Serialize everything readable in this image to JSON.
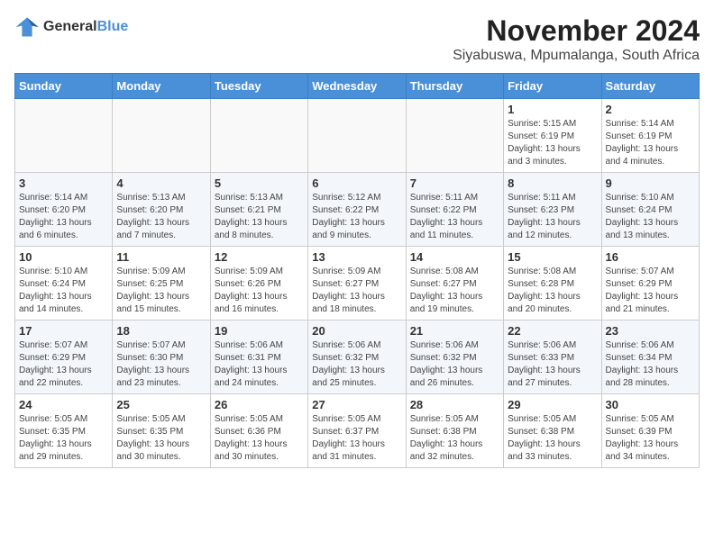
{
  "logo": {
    "line1": "General",
    "line2": "Blue"
  },
  "title": "November 2024",
  "subtitle": "Siyabuswa, Mpumalanga, South Africa",
  "weekdays": [
    "Sunday",
    "Monday",
    "Tuesday",
    "Wednesday",
    "Thursday",
    "Friday",
    "Saturday"
  ],
  "weeks": [
    [
      {
        "day": "",
        "info": ""
      },
      {
        "day": "",
        "info": ""
      },
      {
        "day": "",
        "info": ""
      },
      {
        "day": "",
        "info": ""
      },
      {
        "day": "",
        "info": ""
      },
      {
        "day": "1",
        "info": "Sunrise: 5:15 AM\nSunset: 6:19 PM\nDaylight: 13 hours\nand 3 minutes."
      },
      {
        "day": "2",
        "info": "Sunrise: 5:14 AM\nSunset: 6:19 PM\nDaylight: 13 hours\nand 4 minutes."
      }
    ],
    [
      {
        "day": "3",
        "info": "Sunrise: 5:14 AM\nSunset: 6:20 PM\nDaylight: 13 hours\nand 6 minutes."
      },
      {
        "day": "4",
        "info": "Sunrise: 5:13 AM\nSunset: 6:20 PM\nDaylight: 13 hours\nand 7 minutes."
      },
      {
        "day": "5",
        "info": "Sunrise: 5:13 AM\nSunset: 6:21 PM\nDaylight: 13 hours\nand 8 minutes."
      },
      {
        "day": "6",
        "info": "Sunrise: 5:12 AM\nSunset: 6:22 PM\nDaylight: 13 hours\nand 9 minutes."
      },
      {
        "day": "7",
        "info": "Sunrise: 5:11 AM\nSunset: 6:22 PM\nDaylight: 13 hours\nand 11 minutes."
      },
      {
        "day": "8",
        "info": "Sunrise: 5:11 AM\nSunset: 6:23 PM\nDaylight: 13 hours\nand 12 minutes."
      },
      {
        "day": "9",
        "info": "Sunrise: 5:10 AM\nSunset: 6:24 PM\nDaylight: 13 hours\nand 13 minutes."
      }
    ],
    [
      {
        "day": "10",
        "info": "Sunrise: 5:10 AM\nSunset: 6:24 PM\nDaylight: 13 hours\nand 14 minutes."
      },
      {
        "day": "11",
        "info": "Sunrise: 5:09 AM\nSunset: 6:25 PM\nDaylight: 13 hours\nand 15 minutes."
      },
      {
        "day": "12",
        "info": "Sunrise: 5:09 AM\nSunset: 6:26 PM\nDaylight: 13 hours\nand 16 minutes."
      },
      {
        "day": "13",
        "info": "Sunrise: 5:09 AM\nSunset: 6:27 PM\nDaylight: 13 hours\nand 18 minutes."
      },
      {
        "day": "14",
        "info": "Sunrise: 5:08 AM\nSunset: 6:27 PM\nDaylight: 13 hours\nand 19 minutes."
      },
      {
        "day": "15",
        "info": "Sunrise: 5:08 AM\nSunset: 6:28 PM\nDaylight: 13 hours\nand 20 minutes."
      },
      {
        "day": "16",
        "info": "Sunrise: 5:07 AM\nSunset: 6:29 PM\nDaylight: 13 hours\nand 21 minutes."
      }
    ],
    [
      {
        "day": "17",
        "info": "Sunrise: 5:07 AM\nSunset: 6:29 PM\nDaylight: 13 hours\nand 22 minutes."
      },
      {
        "day": "18",
        "info": "Sunrise: 5:07 AM\nSunset: 6:30 PM\nDaylight: 13 hours\nand 23 minutes."
      },
      {
        "day": "19",
        "info": "Sunrise: 5:06 AM\nSunset: 6:31 PM\nDaylight: 13 hours\nand 24 minutes."
      },
      {
        "day": "20",
        "info": "Sunrise: 5:06 AM\nSunset: 6:32 PM\nDaylight: 13 hours\nand 25 minutes."
      },
      {
        "day": "21",
        "info": "Sunrise: 5:06 AM\nSunset: 6:32 PM\nDaylight: 13 hours\nand 26 minutes."
      },
      {
        "day": "22",
        "info": "Sunrise: 5:06 AM\nSunset: 6:33 PM\nDaylight: 13 hours\nand 27 minutes."
      },
      {
        "day": "23",
        "info": "Sunrise: 5:06 AM\nSunset: 6:34 PM\nDaylight: 13 hours\nand 28 minutes."
      }
    ],
    [
      {
        "day": "24",
        "info": "Sunrise: 5:05 AM\nSunset: 6:35 PM\nDaylight: 13 hours\nand 29 minutes."
      },
      {
        "day": "25",
        "info": "Sunrise: 5:05 AM\nSunset: 6:35 PM\nDaylight: 13 hours\nand 30 minutes."
      },
      {
        "day": "26",
        "info": "Sunrise: 5:05 AM\nSunset: 6:36 PM\nDaylight: 13 hours\nand 30 minutes."
      },
      {
        "day": "27",
        "info": "Sunrise: 5:05 AM\nSunset: 6:37 PM\nDaylight: 13 hours\nand 31 minutes."
      },
      {
        "day": "28",
        "info": "Sunrise: 5:05 AM\nSunset: 6:38 PM\nDaylight: 13 hours\nand 32 minutes."
      },
      {
        "day": "29",
        "info": "Sunrise: 5:05 AM\nSunset: 6:38 PM\nDaylight: 13 hours\nand 33 minutes."
      },
      {
        "day": "30",
        "info": "Sunrise: 5:05 AM\nSunset: 6:39 PM\nDaylight: 13 hours\nand 34 minutes."
      }
    ]
  ]
}
